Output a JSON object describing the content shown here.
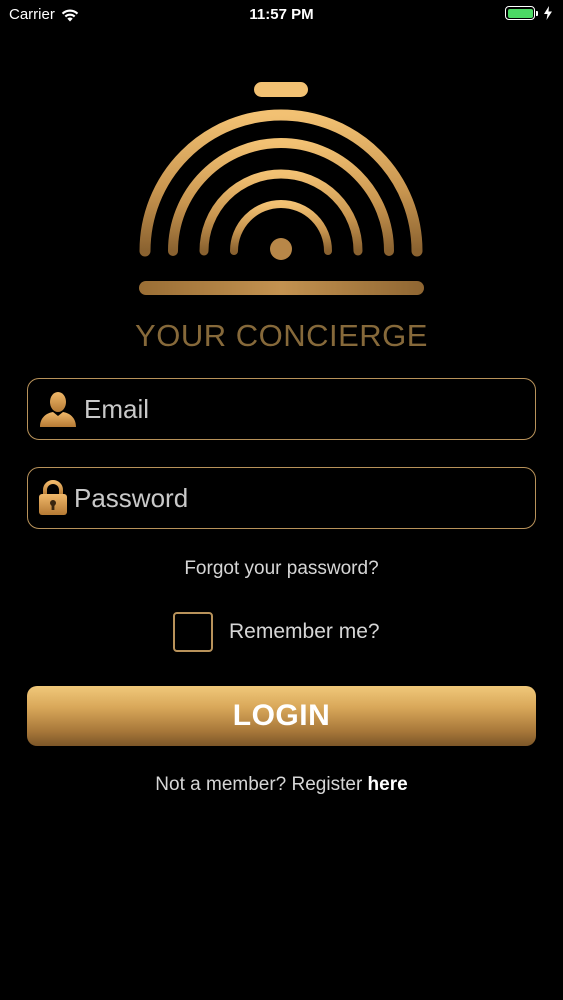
{
  "status_bar": {
    "carrier": "Carrier",
    "time": "11:57 PM",
    "battery_level": 1.0,
    "battery_color": "#4cd964"
  },
  "logo": {
    "icon": "concierge-bell-icon",
    "brand_name": "YOUR CONCIERGE"
  },
  "form": {
    "email_placeholder": "Email",
    "email_icon": "user-icon",
    "password_placeholder": "Password",
    "password_icon": "lock-icon",
    "forgot_link": "Forgot your password?",
    "remember_label": "Remember me?",
    "remember_checked": false,
    "login_label": "LOGIN"
  },
  "register": {
    "prefix": "Not a member? Register ",
    "link": "here"
  },
  "colors": {
    "background": "#000000",
    "accent_gold": "#b8925a",
    "brand_text": "#86693a"
  }
}
